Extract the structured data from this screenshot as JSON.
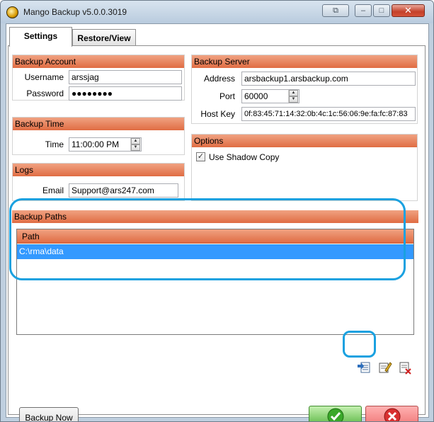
{
  "window": {
    "title": "Mango Backup v5.0.0.3019"
  },
  "tabs": [
    {
      "label": "Settings",
      "active": true
    },
    {
      "label": "Restore/View",
      "active": false
    }
  ],
  "backup_account": {
    "title": "Backup Account",
    "username_label": "Username",
    "username_value": "arssjag",
    "password_label": "Password",
    "password_value": "●●●●●●●●"
  },
  "backup_time": {
    "title": "Backup Time",
    "time_label": "Time",
    "time_value": "11:00:00 PM"
  },
  "logs": {
    "title": "Logs",
    "email_label": "Email",
    "email_value": "Support@ars247.com"
  },
  "backup_server": {
    "title": "Backup Server",
    "address_label": "Address",
    "address_value": "arsbackup1.arsbackup.com",
    "port_label": "Port",
    "port_value": "60000",
    "hostkey_label": "Host Key",
    "hostkey_value": "0f:83:45:71:14:32:0b:4c:1c:56:06:9e:fa:fc:87:83"
  },
  "options": {
    "title": "Options",
    "shadow_copy_label": "Use Shadow Copy",
    "shadow_copy_checked": true
  },
  "backup_paths": {
    "title": "Backup Paths",
    "column_header": "Path",
    "rows": [
      "C:\\rma\\data"
    ]
  },
  "buttons": {
    "backup_now": "Backup Now"
  },
  "colors": {
    "header_orange": "#e06c43",
    "selection_blue": "#3399ff",
    "highlight_overlay": "#1aa1e0",
    "ok_green": "#58b540",
    "cancel_red": "#f07575"
  },
  "icons": {
    "app": "mango-app-icon",
    "add_path": "add-path-icon",
    "edit_path": "edit-path-icon",
    "delete_path": "delete-path-icon",
    "ok": "checkmark-icon",
    "cancel": "x-icon"
  }
}
